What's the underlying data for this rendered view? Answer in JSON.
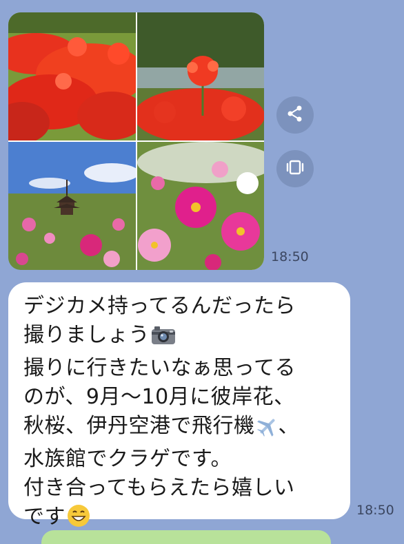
{
  "chat": {
    "photo_message": {
      "time": "18:50",
      "share_icon": "share-icon",
      "keep_icon": "keep-icon"
    },
    "text_message": {
      "time": "18:50",
      "lines": [
        "デジカメ持ってるんだったら",
        "撮りましょう",
        "撮りに行きたいなぁ思ってる",
        "のが、9月〜10月に彼岸花、",
        "秋桜、伊丹空港で飛行機",
        "、",
        "水族館でクラゲです。",
        "付き合ってもらえたら嬉しい",
        "です"
      ],
      "icons": [
        "camera-emoji",
        "airplane-emoji",
        "grinning-emoji"
      ]
    }
  },
  "colors": {
    "background": "#8fa6d4",
    "bubble": "#ffffff",
    "sent_bubble": "#b8e29a"
  }
}
